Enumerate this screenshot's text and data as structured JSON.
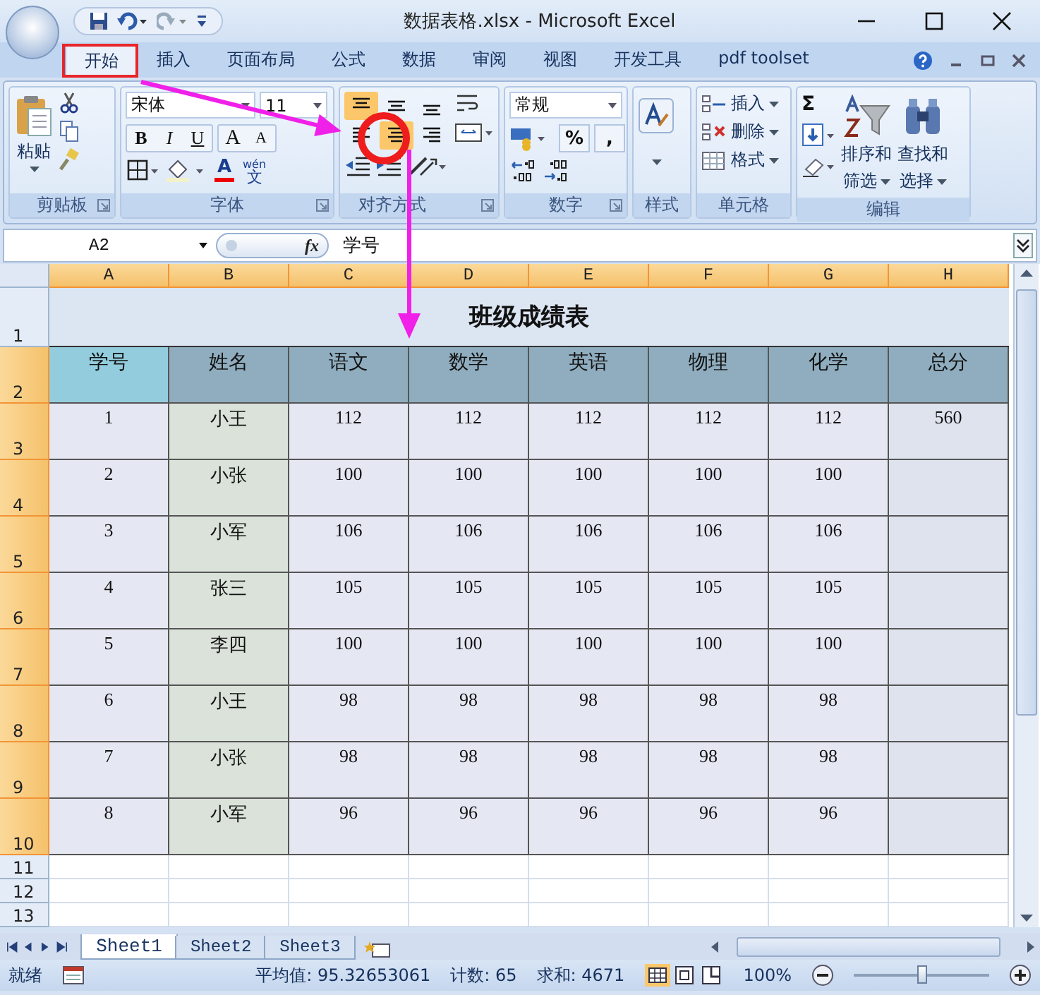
{
  "window": {
    "title": "数据表格.xlsx - Microsoft Excel"
  },
  "tabs": [
    {
      "label": "开始",
      "selected": true
    },
    {
      "label": "插入",
      "selected": false
    },
    {
      "label": "页面布局",
      "selected": false
    },
    {
      "label": "公式",
      "selected": false
    },
    {
      "label": "数据",
      "selected": false
    },
    {
      "label": "审阅",
      "selected": false
    },
    {
      "label": "视图",
      "selected": false
    },
    {
      "label": "开发工具",
      "selected": false
    },
    {
      "label": "pdf toolset",
      "selected": false
    }
  ],
  "ribbon": {
    "groups": [
      {
        "kind": "clipboard",
        "label": "剪贴板",
        "paste": "粘贴"
      },
      {
        "kind": "font",
        "label": "字体",
        "font_name": "宋体",
        "font_size": "11",
        "style_buttons": [
          "B",
          "I",
          "U"
        ],
        "size_buttons": [
          "A",
          "A"
        ],
        "color_letter": "A",
        "phonetic": [
          "wén",
          "文"
        ]
      },
      {
        "kind": "alignment",
        "label": "对齐方式",
        "align_buttons": [
          {
            "kind": "top",
            "selected": true
          },
          {
            "kind": "middle",
            "selected": false
          },
          {
            "kind": "bottom",
            "selected": false
          },
          {
            "kind": "left",
            "selected": false
          },
          {
            "kind": "center",
            "selected": true
          },
          {
            "kind": "right",
            "selected": false
          }
        ]
      },
      {
        "kind": "number",
        "label": "数字",
        "format": "常规",
        "buttons": [
          "%",
          ","
        ]
      },
      {
        "kind": "styles",
        "label": "样式"
      },
      {
        "kind": "cells",
        "label": "单元格",
        "items": [
          {
            "kind": "insert",
            "label": "插入"
          },
          {
            "kind": "delete",
            "label": "删除"
          },
          {
            "kind": "format",
            "label": "格式"
          }
        ]
      },
      {
        "kind": "editing",
        "label": "编辑",
        "sum": "Σ",
        "sort": [
          "排序和",
          "筛选"
        ],
        "find": [
          "查找和",
          "选择"
        ]
      }
    ]
  },
  "formula_bar": {
    "name_box": "A2",
    "function_label": "fx",
    "formula": "学号"
  },
  "sheet": {
    "columns": [
      {
        "label": "A",
        "selected": true
      },
      {
        "label": "B",
        "selected": true
      },
      {
        "label": "C",
        "selected": true
      },
      {
        "label": "D",
        "selected": true
      },
      {
        "label": "E",
        "selected": true
      },
      {
        "label": "F",
        "selected": true
      },
      {
        "label": "G",
        "selected": true
      },
      {
        "label": "H",
        "selected": true
      }
    ],
    "rows": [
      {
        "number": "1",
        "selected": false,
        "kind": "title",
        "text": "班级成绩表"
      },
      {
        "number": "2",
        "selected": true,
        "kind": "header",
        "cells": [
          {
            "text": "学号",
            "selected": true
          },
          {
            "text": "姓名",
            "selected": false
          },
          {
            "text": "语文",
            "selected": false
          },
          {
            "text": "数学",
            "selected": false
          },
          {
            "text": "英语",
            "selected": false
          },
          {
            "text": "物理",
            "selected": false
          },
          {
            "text": "化学",
            "selected": false
          },
          {
            "text": "总分",
            "selected": false
          }
        ]
      },
      {
        "number": "3",
        "selected": true,
        "kind": "data",
        "cells": [
          "1",
          "小王",
          "112",
          "112",
          "112",
          "112",
          "112",
          "560"
        ]
      },
      {
        "number": "4",
        "selected": true,
        "kind": "data",
        "cells": [
          "2",
          "小张",
          "100",
          "100",
          "100",
          "100",
          "100"
        ]
      },
      {
        "number": "5",
        "selected": true,
        "kind": "data",
        "cells": [
          "3",
          "小军",
          "106",
          "106",
          "106",
          "106",
          "106"
        ]
      },
      {
        "number": "6",
        "selected": true,
        "kind": "data",
        "cells": [
          "4",
          "张三",
          "105",
          "105",
          "105",
          "105",
          "105"
        ]
      },
      {
        "number": "7",
        "selected": true,
        "kind": "data",
        "cells": [
          "5",
          "李四",
          "100",
          "100",
          "100",
          "100",
          "100"
        ]
      },
      {
        "number": "8",
        "selected": true,
        "kind": "data",
        "cells": [
          "6",
          "小王",
          "98",
          "98",
          "98",
          "98",
          "98"
        ]
      },
      {
        "number": "9",
        "selected": true,
        "kind": "data",
        "cells": [
          "7",
          "小张",
          "98",
          "98",
          "98",
          "98",
          "98"
        ]
      },
      {
        "number": "10",
        "selected": true,
        "kind": "data",
        "cells": [
          "8",
          "小军",
          "96",
          "96",
          "96",
          "96",
          "96"
        ]
      },
      {
        "number": "11",
        "selected": false,
        "kind": "empty"
      },
      {
        "number": "12",
        "selected": false,
        "kind": "empty"
      },
      {
        "number": "13",
        "selected": false,
        "kind": "empty"
      }
    ]
  },
  "sheet_tabs": [
    {
      "label": "Sheet1",
      "selected": true
    },
    {
      "label": "Sheet2",
      "selected": false
    },
    {
      "label": "Sheet3",
      "selected": false
    }
  ],
  "status_bar": {
    "state": "就绪",
    "average": "平均值: 95.32653061",
    "count": "计数: 65",
    "sum": "求和: 4671",
    "views": [
      {
        "kind": "normal",
        "selected": true
      },
      {
        "kind": "layout",
        "selected": false
      },
      {
        "kind": "break",
        "selected": false
      }
    ],
    "zoom": "100%",
    "zoom_slider": {
      "level": 0.5
    }
  },
  "annotations": [
    {
      "kind": "box"
    },
    {
      "kind": "arrow"
    },
    {
      "kind": "circle"
    },
    {
      "kind": "arrow"
    }
  ]
}
